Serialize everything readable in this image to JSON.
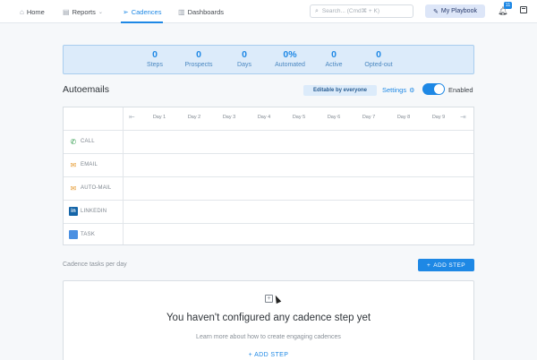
{
  "nav": {
    "home_label": "Home",
    "reports_label": "Reports",
    "cadences_label": "Cadences",
    "dashboards_label": "Dashboards",
    "search_placeholder": "Search... (Cmd⌘ + K)",
    "playbook_label": "My Playbook",
    "notification_count": "11"
  },
  "stats": [
    {
      "value": "0",
      "label": "Steps"
    },
    {
      "value": "0",
      "label": "Prospects"
    },
    {
      "value": "0",
      "label": "Days"
    },
    {
      "value": "0%",
      "label": "Automated"
    },
    {
      "value": "0",
      "label": "Active"
    },
    {
      "value": "0",
      "label": "Opted-out"
    }
  ],
  "autoemails": {
    "title": "Autoemails",
    "editable_badge": "Editable by everyone",
    "settings_label": "Settings",
    "enabled_label": "Enabled",
    "enabled": true
  },
  "grid": {
    "days": [
      "Day 1",
      "Day 2",
      "Day 3",
      "Day 4",
      "Day 5",
      "Day 6",
      "Day 7",
      "Day 8",
      "Day 9"
    ],
    "rows": [
      {
        "label": "CALL",
        "icon": "phone-icon"
      },
      {
        "label": "EMAIL",
        "icon": "envelope-icon"
      },
      {
        "label": "AUTO-MAIL",
        "icon": "auto-mail-icon"
      },
      {
        "label": "LINKEDIN",
        "icon": "linkedin-icon"
      },
      {
        "label": "TASK",
        "icon": "task-icon"
      }
    ]
  },
  "tasks": {
    "label": "Cadence tasks per day",
    "add_step_button": "ADD STEP"
  },
  "empty_state": {
    "title": "You haven't configured any cadence step yet",
    "subtitle": "Learn more about how to create engaging cadences",
    "add_step_link": "ADD STEP"
  },
  "colors": {
    "accent": "#1e88e5",
    "stats_bg": "#dcebfa",
    "playbook_bg": "#dde6f8"
  }
}
